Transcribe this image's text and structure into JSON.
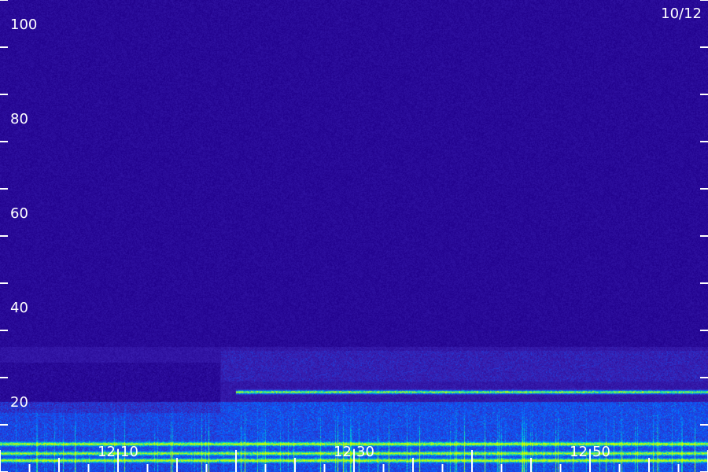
{
  "chart_data": {
    "type": "heatmap",
    "title": "",
    "date_label": "10/12",
    "y_axis": {
      "label": "",
      "range": [
        10,
        110
      ],
      "tick_labels": [
        "100",
        "80",
        "60",
        "40",
        "20"
      ],
      "tick_values": [
        100,
        80,
        60,
        40,
        20
      ],
      "minor_tick_values": [
        110,
        90,
        70,
        50,
        30,
        10
      ]
    },
    "x_axis": {
      "label": "",
      "tick_labels": [
        "12:10",
        "12:30",
        "12:50"
      ],
      "range_minutes": [
        "12:00",
        "13:00"
      ]
    },
    "colormap": [
      "#000000",
      "#20008c",
      "#3a1fb0",
      "#0a5cff",
      "#00d8c8",
      "#c8ff00"
    ],
    "bands": [
      {
        "name": "",
        "freq": 27,
        "start": "12:20",
        "end": "13:00",
        "intensity": 0.75
      },
      {
        "name": "",
        "freq": 16,
        "start": "12:00",
        "end": "13:00",
        "intensity": 0.6
      },
      {
        "name": "",
        "freq": 14,
        "start": "12:00",
        "end": "13:00",
        "intensity": 0.55
      },
      {
        "name": "",
        "freq": 12.5,
        "start": "12:00",
        "end": "13:00",
        "intensity": 0.6
      }
    ]
  }
}
